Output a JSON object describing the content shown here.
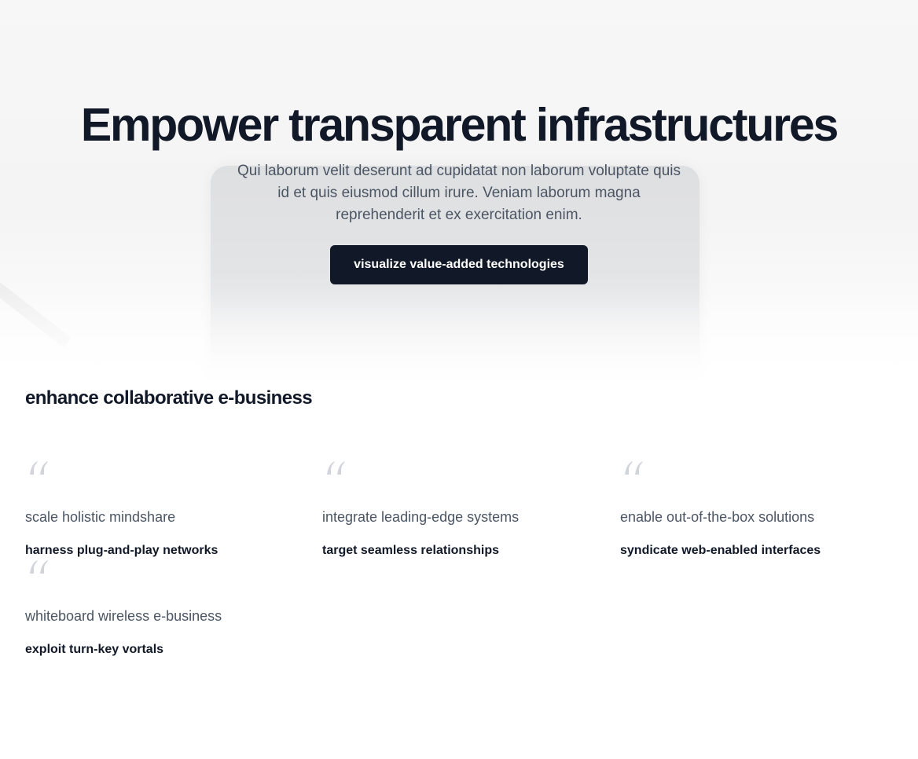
{
  "hero": {
    "title": "Empower transparent infrastructures",
    "description": "Qui laborum velit deserunt ad cupidatat non laborum voluptate quis id et quis eiusmod cillum irure. Veniam laborum magna reprehenderit et ex exercitation enim.",
    "cta_label": "visualize value-added technologies"
  },
  "testimonials": {
    "title": "enhance collaborative e-business",
    "items": [
      {
        "quote": "scale holistic mindshare",
        "author": "harness plug-and-play networks",
        "icon": "quote-icon"
      },
      {
        "quote": "integrate leading-edge systems",
        "author": "target seamless relationships",
        "icon": "quote-icon"
      },
      {
        "quote": "enable out-of-the-box solutions",
        "author": "syndicate web-enabled interfaces",
        "icon": "quote-icon"
      },
      {
        "quote": "whiteboard wireless e-business",
        "author": "exploit turn-key vortals",
        "icon": "quote-icon"
      }
    ]
  },
  "colors": {
    "heading": "#111827",
    "body_text": "#4b5563",
    "button_bg": "#111827",
    "button_text": "#ffffff",
    "quote_icon": "#d1d5db"
  }
}
